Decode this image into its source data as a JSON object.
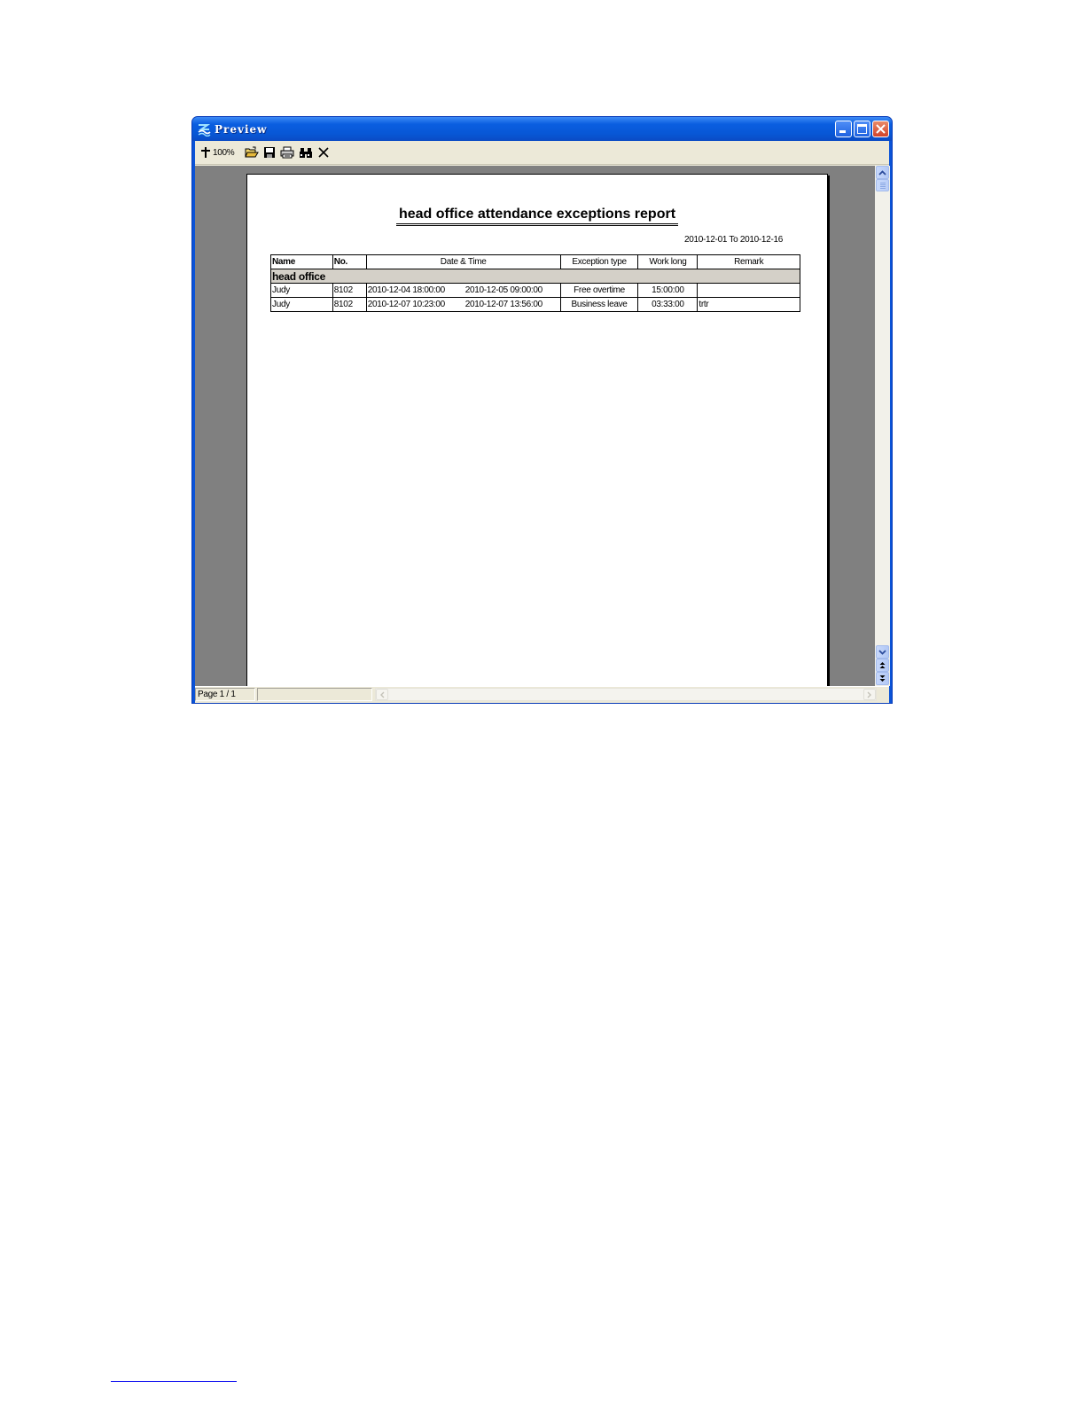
{
  "window": {
    "title": "Preview"
  },
  "toolbar": {
    "zoom_label": "100%",
    "buttons": [
      "zoom-icon",
      "open-folder-icon",
      "save-disk-icon",
      "printer-icon",
      "binoculars-icon",
      "close-x-icon"
    ]
  },
  "report": {
    "title": "head office attendance exceptions report",
    "date_range": "2010-12-01 To 2010-12-16",
    "headers": {
      "name": "Name",
      "no": "No.",
      "datetime": "Date & Time",
      "exception_type": "Exception type",
      "work_long": "Work long",
      "remark": "Remark"
    },
    "group": "head office",
    "rows": [
      {
        "name": "Judy",
        "no": "8102",
        "start": "2010-12-04 18:00:00",
        "end": "2010-12-05 09:00:00",
        "exception_type": "Free overtime",
        "work_long": "15:00:00",
        "remark": ""
      },
      {
        "name": "Judy",
        "no": "8102",
        "start": "2010-12-07 10:23:00",
        "end": "2010-12-07 13:56:00",
        "exception_type": "Business leave",
        "work_long": "03:33:00",
        "remark": "trtr"
      }
    ]
  },
  "statusbar": {
    "page_label": "Page 1 / 1"
  },
  "colors": {
    "titlebar": "#0a5ee0",
    "preview_background": "#808080",
    "dialog_face": "#ece9d8",
    "group_row": "#d4d0c8"
  }
}
